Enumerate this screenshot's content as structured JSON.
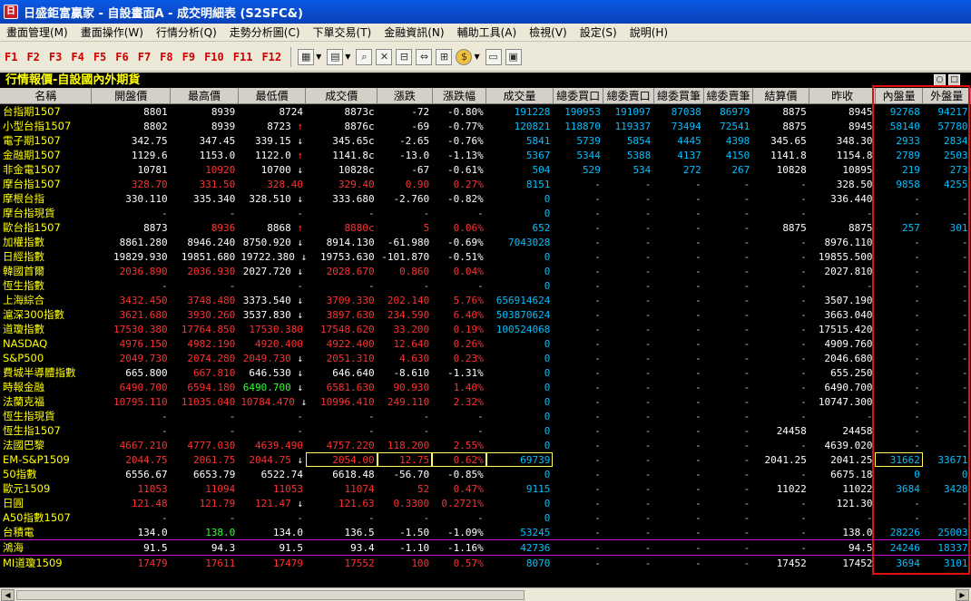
{
  "window": {
    "title": "日盛鉅富贏家 - 自設畫面A - 成交明細表 (S2SFC&)"
  },
  "menu": [
    "畫面管理(M)",
    "畫面操作(W)",
    "行情分析(Q)",
    "走勢分析圖(C)",
    "下單交易(T)",
    "金融資訊(N)",
    "輔助工具(A)",
    "檢視(V)",
    "設定(S)",
    "說明(H)"
  ],
  "toolbar": {
    "fkeys": [
      "F1",
      "F2",
      "F3",
      "F4",
      "F5",
      "F6",
      "F7",
      "F8",
      "F9",
      "F10",
      "F11",
      "F12"
    ]
  },
  "panel": {
    "title": "行情報價-自設國內外期貨"
  },
  "columns": [
    "名稱",
    "開盤價",
    "最高價",
    "最低價",
    "成交價",
    "漲跌",
    "漲跌幅",
    "成交量",
    "總委買口",
    "總委賣口",
    "總委買筆",
    "總委賣筆",
    "結算價",
    "昨收",
    "內盤量",
    "外盤量"
  ],
  "rows": [
    {
      "name": "台指期1507",
      "open": "8801",
      "high": "8939",
      "low": "8724",
      "arrow": "",
      "price": "8873c",
      "chg": "-72",
      "pct": "-0.80%",
      "vol": "191228",
      "bq": "190953",
      "sq": "191097",
      "bn": "87038",
      "sn": "86979",
      "settle": "8875",
      "prev": "8945",
      "inner": "92768",
      "outer": "94217",
      "color": "dn"
    },
    {
      "name": "小型台指1507",
      "open": "8802",
      "high": "8939",
      "low": "8723",
      "arrow": "up",
      "price": "8876c",
      "chg": "-69",
      "pct": "-0.77%",
      "vol": "120821",
      "bq": "118870",
      "sq": "119337",
      "bn": "73494",
      "sn": "72541",
      "settle": "8875",
      "prev": "8945",
      "inner": "58140",
      "outer": "57780",
      "color": "dn"
    },
    {
      "name": "電子期1507",
      "open": "342.75",
      "high": "347.45",
      "low": "339.15",
      "arrow": "dn",
      "price": "345.65c",
      "chg": "-2.65",
      "pct": "-0.76%",
      "vol": "5841",
      "bq": "5739",
      "sq": "5854",
      "bn": "4445",
      "sn": "4398",
      "settle": "345.65",
      "prev": "348.30",
      "inner": "2933",
      "outer": "2834",
      "color": "dn"
    },
    {
      "name": "金融期1507",
      "open": "1129.6",
      "high": "1153.0",
      "low": "1122.0",
      "arrow": "up",
      "price": "1141.8c",
      "chg": "-13.0",
      "pct": "-1.13%",
      "vol": "5367",
      "bq": "5344",
      "sq": "5388",
      "bn": "4137",
      "sn": "4150",
      "settle": "1141.8",
      "prev": "1154.8",
      "inner": "2789",
      "outer": "2503",
      "color": "dn"
    },
    {
      "name": "非金電1507",
      "open": "10781",
      "high": "10920",
      "low": "10700",
      "arrow": "dn",
      "price": "10828c",
      "chg": "-67",
      "pct": "-0.61%",
      "vol": "504",
      "bq": "529",
      "sq": "534",
      "bn": "272",
      "sn": "267",
      "settle": "10828",
      "prev": "10895",
      "inner": "219",
      "outer": "273",
      "color": "dn",
      "highColor": "up"
    },
    {
      "name": "摩台指1507",
      "open": "328.70",
      "high": "331.50",
      "low": "328.40",
      "arrow": "",
      "price": "329.40",
      "chg": "0.90",
      "pct": "0.27%",
      "vol": "8151",
      "bq": "-",
      "sq": "-",
      "bn": "-",
      "sn": "-",
      "settle": "-",
      "prev": "328.50",
      "inner": "9858",
      "outer": "4255",
      "color": "up"
    },
    {
      "name": "摩根台指",
      "open": "330.110",
      "high": "335.340",
      "low": "328.510",
      "arrow": "dn",
      "price": "333.680",
      "chg": "-2.760",
      "pct": "-0.82%",
      "vol": "0",
      "bq": "-",
      "sq": "-",
      "bn": "-",
      "sn": "-",
      "settle": "-",
      "prev": "336.440",
      "inner": "-",
      "outer": "-",
      "color": "dn"
    },
    {
      "name": "摩台指現貨",
      "open": "-",
      "high": "-",
      "low": "-",
      "arrow": "",
      "price": "-",
      "chg": "-",
      "pct": "-",
      "vol": "0",
      "bq": "-",
      "sq": "-",
      "bn": "-",
      "sn": "-",
      "settle": "-",
      "prev": "-",
      "inner": "-",
      "outer": "-",
      "color": "dn"
    },
    {
      "name": "歐台指1507",
      "open": "8873",
      "high": "8936",
      "low": "8868",
      "arrow": "up",
      "price": "8880c",
      "chg": "5",
      "pct": "0.06%",
      "vol": "652",
      "bq": "-",
      "sq": "-",
      "bn": "-",
      "sn": "-",
      "settle": "8875",
      "prev": "8875",
      "inner": "257",
      "outer": "301",
      "color": "up",
      "openColor": "dn",
      "lowColor": "dn"
    },
    {
      "name": "加權指數",
      "open": "8861.280",
      "high": "8946.240",
      "low": "8750.920",
      "arrow": "dn",
      "price": "8914.130",
      "chg": "-61.980",
      "pct": "-0.69%",
      "vol": "7043028",
      "bq": "-",
      "sq": "-",
      "bn": "-",
      "sn": "-",
      "settle": "-",
      "prev": "8976.110",
      "inner": "-",
      "outer": "-",
      "color": "dn"
    },
    {
      "name": "日經指數",
      "open": "19829.930",
      "high": "19851.680",
      "low": "19722.380",
      "arrow": "dn",
      "price": "19753.630",
      "chg": "-101.870",
      "pct": "-0.51%",
      "vol": "0",
      "bq": "-",
      "sq": "-",
      "bn": "-",
      "sn": "-",
      "settle": "-",
      "prev": "19855.500",
      "inner": "-",
      "outer": "-",
      "color": "dn"
    },
    {
      "name": "韓國首爾",
      "open": "2036.890",
      "high": "2036.930",
      "low": "2027.720",
      "arrow": "dn",
      "price": "2028.670",
      "chg": "0.860",
      "pct": "0.04%",
      "vol": "0",
      "bq": "-",
      "sq": "-",
      "bn": "-",
      "sn": "-",
      "settle": "-",
      "prev": "2027.810",
      "inner": "-",
      "outer": "-",
      "color": "up",
      "lowColor": "dn"
    },
    {
      "name": "恆生指數",
      "open": "-",
      "high": "-",
      "low": "-",
      "arrow": "",
      "price": "-",
      "chg": "-",
      "pct": "-",
      "vol": "0",
      "bq": "-",
      "sq": "-",
      "bn": "-",
      "sn": "-",
      "settle": "-",
      "prev": "-",
      "inner": "-",
      "outer": "-",
      "color": "dn"
    },
    {
      "name": "上海綜合",
      "open": "3432.450",
      "high": "3748.480",
      "low": "3373.540",
      "arrow": "dn",
      "price": "3709.330",
      "chg": "202.140",
      "pct": "5.76%",
      "vol": "656914624",
      "bq": "-",
      "sq": "-",
      "bn": "-",
      "sn": "-",
      "settle": "-",
      "prev": "3507.190",
      "inner": "-",
      "outer": "-",
      "color": "up",
      "lowColor": "dn"
    },
    {
      "name": "滬深300指數",
      "open": "3621.680",
      "high": "3930.260",
      "low": "3537.830",
      "arrow": "dn",
      "price": "3897.630",
      "chg": "234.590",
      "pct": "6.40%",
      "vol": "503870624",
      "bq": "-",
      "sq": "-",
      "bn": "-",
      "sn": "-",
      "settle": "-",
      "prev": "3663.040",
      "inner": "-",
      "outer": "-",
      "color": "up",
      "lowColor": "dn"
    },
    {
      "name": "道瓊指數",
      "open": "17530.380",
      "high": "17764.850",
      "low": "17530.380",
      "arrow": "",
      "price": "17548.620",
      "chg": "33.200",
      "pct": "0.19%",
      "vol": "100524068",
      "bq": "-",
      "sq": "-",
      "bn": "-",
      "sn": "-",
      "settle": "-",
      "prev": "17515.420",
      "inner": "-",
      "outer": "-",
      "color": "up"
    },
    {
      "name": "NASDAQ",
      "open": "4976.150",
      "high": "4982.190",
      "low": "4920.400",
      "arrow": "",
      "price": "4922.400",
      "chg": "12.640",
      "pct": "0.26%",
      "vol": "0",
      "bq": "-",
      "sq": "-",
      "bn": "-",
      "sn": "-",
      "settle": "-",
      "prev": "4909.760",
      "inner": "-",
      "outer": "-",
      "color": "up"
    },
    {
      "name": "S&P500",
      "open": "2049.730",
      "high": "2074.280",
      "low": "2049.730",
      "arrow": "dn",
      "price": "2051.310",
      "chg": "4.630",
      "pct": "0.23%",
      "vol": "0",
      "bq": "-",
      "sq": "-",
      "bn": "-",
      "sn": "-",
      "settle": "-",
      "prev": "2046.680",
      "inner": "-",
      "outer": "-",
      "color": "up"
    },
    {
      "name": "費城半導體指數",
      "open": "665.800",
      "high": "667.810",
      "low": "646.530",
      "arrow": "dn",
      "price": "646.640",
      "chg": "-8.610",
      "pct": "-1.31%",
      "vol": "0",
      "bq": "-",
      "sq": "-",
      "bn": "-",
      "sn": "-",
      "settle": "-",
      "prev": "655.250",
      "inner": "-",
      "outer": "-",
      "color": "dn",
      "highColor": "up"
    },
    {
      "name": "時報金融",
      "open": "6490.700",
      "high": "6594.180",
      "low": "6490.700",
      "arrow": "dn",
      "price": "6581.630",
      "chg": "90.930",
      "pct": "1.40%",
      "vol": "0",
      "bq": "-",
      "sq": "-",
      "bn": "-",
      "sn": "-",
      "settle": "-",
      "prev": "6490.700",
      "inner": "-",
      "outer": "-",
      "color": "up",
      "lowColor": "green"
    },
    {
      "name": "法蘭克福",
      "open": "10795.110",
      "high": "11035.040",
      "low": "10784.470",
      "arrow": "dn",
      "price": "10996.410",
      "chg": "249.110",
      "pct": "2.32%",
      "vol": "0",
      "bq": "-",
      "sq": "-",
      "bn": "-",
      "sn": "-",
      "settle": "-",
      "prev": "10747.300",
      "inner": "-",
      "outer": "-",
      "color": "up"
    },
    {
      "name": "恆生指現貨",
      "open": "-",
      "high": "-",
      "low": "-",
      "arrow": "",
      "price": "-",
      "chg": "-",
      "pct": "-",
      "vol": "0",
      "bq": "-",
      "sq": "-",
      "bn": "-",
      "sn": "-",
      "settle": "-",
      "prev": "-",
      "inner": "-",
      "outer": "-",
      "color": "dn"
    },
    {
      "name": "恆生指1507",
      "open": "-",
      "high": "-",
      "low": "-",
      "arrow": "",
      "price": "-",
      "chg": "-",
      "pct": "-",
      "vol": "0",
      "bq": "-",
      "sq": "-",
      "bn": "-",
      "sn": "-",
      "settle": "24458",
      "prev": "24458",
      "inner": "-",
      "outer": "-",
      "color": "dn"
    },
    {
      "name": "法國巴黎",
      "open": "4667.210",
      "high": "4777.030",
      "low": "4639.490",
      "arrow": "",
      "price": "4757.220",
      "chg": "118.200",
      "pct": "2.55%",
      "vol": "0",
      "bq": "-",
      "sq": "-",
      "bn": "-",
      "sn": "-",
      "settle": "-",
      "prev": "4639.020",
      "inner": "-",
      "outer": "-",
      "color": "up"
    },
    {
      "name": "EM-S&P1509",
      "open": "2044.75",
      "high": "2061.75",
      "low": "2044.75",
      "arrow": "dn",
      "price": "2054.00",
      "chg": "12.75",
      "pct": "0.62%",
      "vol": "69739",
      "bq": "-",
      "sq": "-",
      "bn": "-",
      "sn": "-",
      "settle": "2041.25",
      "prev": "2041.25",
      "inner": "31662",
      "outer": "33671",
      "color": "up",
      "boxed": true
    },
    {
      "name": "50指數",
      "open": "6556.67",
      "high": "6653.79",
      "low": "6522.74",
      "arrow": "",
      "price": "6618.48",
      "chg": "-56.70",
      "pct": "-0.85%",
      "vol": "0",
      "bq": "-",
      "sq": "-",
      "bn": "-",
      "sn": "-",
      "settle": "-",
      "prev": "6675.18",
      "inner": "0",
      "outer": "0",
      "color": "dn"
    },
    {
      "name": "歐元1509",
      "open": "11053",
      "high": "11094",
      "low": "11053",
      "arrow": "",
      "price": "11074",
      "chg": "52",
      "pct": "0.47%",
      "vol": "9115",
      "bq": "-",
      "sq": "-",
      "bn": "-",
      "sn": "-",
      "settle": "11022",
      "prev": "11022",
      "inner": "3684",
      "outer": "3428",
      "color": "up"
    },
    {
      "name": "日圓",
      "open": "121.48",
      "high": "121.79",
      "low": "121.47",
      "arrow": "dn",
      "price": "121.63",
      "chg": "0.3300",
      "pct": "0.2721%",
      "vol": "0",
      "bq": "-",
      "sq": "-",
      "bn": "-",
      "sn": "-",
      "settle": "-",
      "prev": "121.30",
      "inner": "-",
      "outer": "-",
      "color": "up"
    },
    {
      "name": "A50指數1507",
      "open": "-",
      "high": "-",
      "low": "-",
      "arrow": "",
      "price": "-",
      "chg": "-",
      "pct": "-",
      "vol": "0",
      "bq": "-",
      "sq": "-",
      "bn": "-",
      "sn": "-",
      "settle": "-",
      "prev": "-",
      "inner": "-",
      "outer": "-",
      "color": "dn"
    },
    {
      "name": "台積電",
      "open": "134.0",
      "high": "138.0",
      "low": "134.0",
      "arrow": "",
      "price": "136.5",
      "chg": "-1.50",
      "pct": "-1.09%",
      "vol": "53245",
      "bq": "-",
      "sq": "-",
      "bn": "-",
      "sn": "-",
      "settle": "-",
      "prev": "138.0",
      "inner": "28226",
      "outer": "25003",
      "color": "dn",
      "highColor": "green"
    },
    {
      "name": "鴻海",
      "open": "91.5",
      "high": "94.3",
      "low": "91.5",
      "arrow": "",
      "price": "93.4",
      "chg": "-1.10",
      "pct": "-1.16%",
      "vol": "42736",
      "bq": "-",
      "sq": "-",
      "bn": "-",
      "sn": "-",
      "settle": "-",
      "prev": "94.5",
      "inner": "24246",
      "outer": "18337",
      "color": "dn",
      "hl": true
    },
    {
      "name": "MI道瓊1509",
      "open": "17479",
      "high": "17611",
      "low": "17479",
      "arrow": "",
      "price": "17552",
      "chg": "100",
      "pct": "0.57%",
      "vol": "8070",
      "bq": "-",
      "sq": "-",
      "bn": "-",
      "sn": "-",
      "settle": "17452",
      "prev": "17452",
      "inner": "3694",
      "outer": "3101",
      "color": "up",
      "hl": true
    }
  ]
}
